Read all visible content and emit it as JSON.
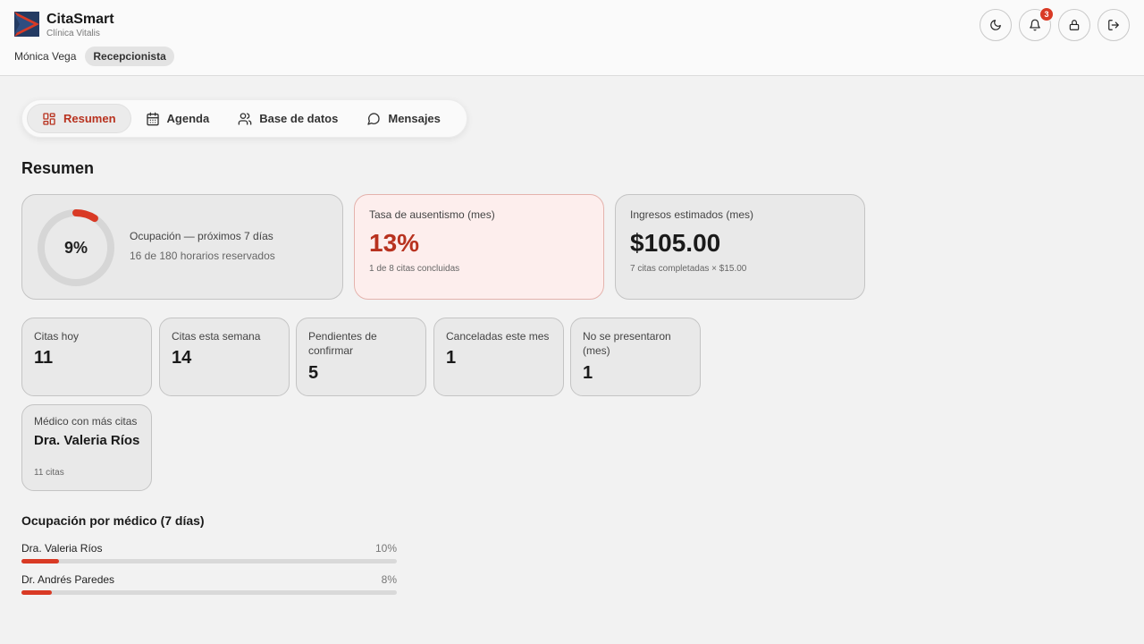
{
  "brand": {
    "name": "CitaSmart",
    "clinic": "Clínica Vitalis"
  },
  "user": {
    "name": "Mónica Vega",
    "role": "Recepcionista"
  },
  "header": {
    "notifications_count": "3"
  },
  "tabs": [
    {
      "label": "Resumen",
      "active": true
    },
    {
      "label": "Agenda",
      "active": false
    },
    {
      "label": "Base de datos",
      "active": false
    },
    {
      "label": "Mensajes",
      "active": false
    }
  ],
  "summary": {
    "title": "Resumen",
    "occupancy": {
      "percent_label": "9%",
      "fraction": 0.09,
      "label": "Ocupación — próximos 7 días",
      "detail": "16 de 180 horarios reservados"
    },
    "absence": {
      "label": "Tasa de ausentismo (mes)",
      "value": "13%",
      "note": "1 de 8 citas concluidas"
    },
    "income": {
      "label": "Ingresos estimados (mes)",
      "value": "$105.00",
      "note": "7 citas completadas × $15.00"
    },
    "stats": [
      {
        "label": "Citas hoy",
        "value": "11"
      },
      {
        "label": "Citas esta semana",
        "value": "14"
      },
      {
        "label": "Pendientes de confirmar",
        "value": "5"
      },
      {
        "label": "Canceladas este mes",
        "value": "1"
      },
      {
        "label": "No se presentaron (mes)",
        "value": "1"
      }
    ],
    "top_doctor": {
      "label": "Médico con más citas",
      "name": "Dra. Valeria Ríos",
      "count": "11 citas"
    }
  },
  "doctor_occupancy": {
    "title": "Ocupación por médico (7 días)",
    "rows": [
      {
        "name": "Dra. Valeria Ríos",
        "percent_label": "10%",
        "fraction": 0.1
      },
      {
        "name": "Dr. Andrés Paredes",
        "percent_label": "8%",
        "fraction": 0.08
      }
    ]
  },
  "colors": {
    "accent": "#d93a25",
    "accent_text": "#b8321f",
    "brand_navy": "#243b63"
  }
}
